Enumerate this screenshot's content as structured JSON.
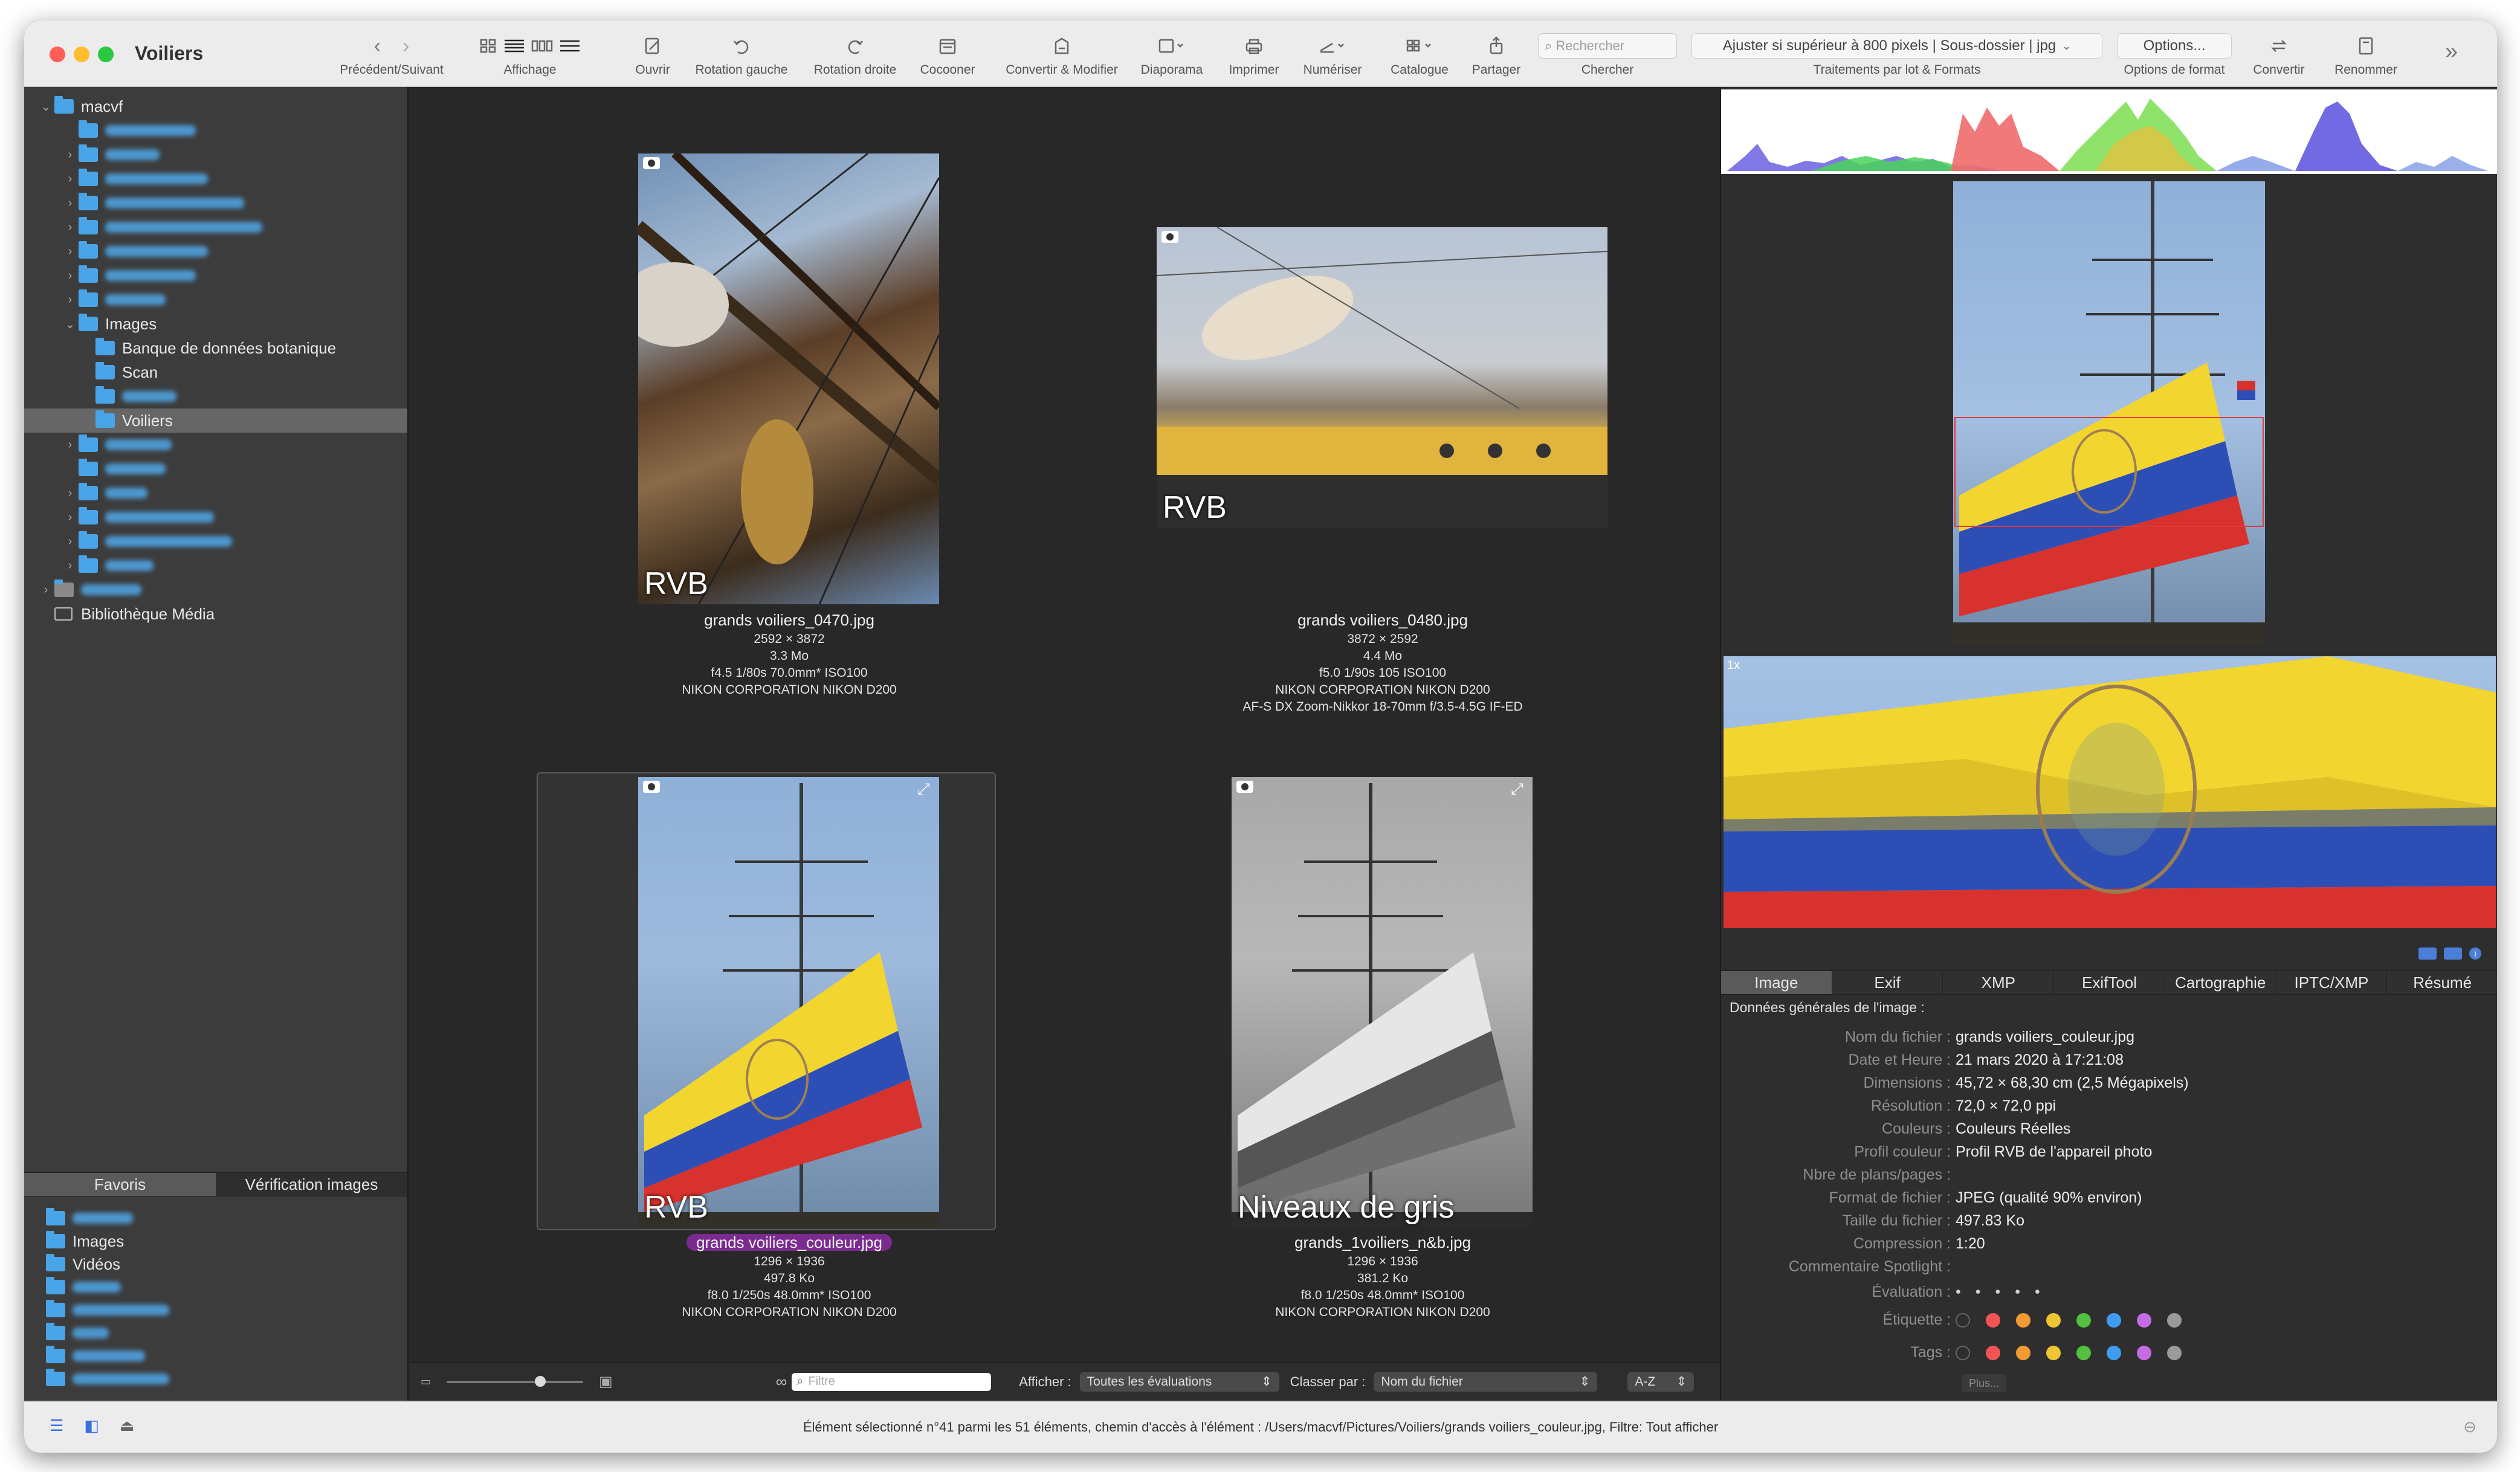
{
  "window": {
    "title": "Voiliers"
  },
  "toolbar": {
    "nav_label": "Précédent/Suivant",
    "view_label": "Affichage",
    "open_label": "Ouvrir",
    "rotate_left_label": "Rotation gauche",
    "rotate_right_label": "Rotation droite",
    "cocoon_label": "Cocooner",
    "convert_modify_label": "Convertir & Modifier",
    "slideshow_label": "Diaporama",
    "print_label": "Imprimer",
    "scan_label": "Numériser",
    "catalog_label": "Catalogue",
    "share_label": "Partager",
    "search_placeholder": "Rechercher",
    "search_label": "Chercher",
    "batch_value": "Ajuster si supérieur à 800 pixels | Sous-dossier | jpg",
    "batch_label": "Traitements par lot & Formats",
    "options_button": "Options...",
    "options_label": "Options de format",
    "convert_label": "Convertir",
    "rename_label": "Renommer"
  },
  "sidebar": {
    "root": "macvf",
    "images_folder": "Images",
    "subfolders": [
      "Banque de données botanique",
      "Scan",
      "Voiliers"
    ],
    "media_library": "Bibliothèque Média",
    "tabs": [
      "Favoris",
      "Vérification images"
    ],
    "favorites": [
      "Images",
      "Vidéos"
    ]
  },
  "thumbnails": [
    {
      "filename": "grands voiliers_0470.jpg",
      "dimensions": "2592 × 3872",
      "size": "3.3  Mo",
      "exposure": "f4.5 1/80s 70.0mm* ISO100",
      "camera": "NIKON CORPORATION NIKON D200",
      "lens": "",
      "badge": "RVB"
    },
    {
      "filename": "grands voiliers_0480.jpg",
      "dimensions": "3872 × 2592",
      "size": "4.4  Mo",
      "exposure": "f5.0 1/90s 105 ISO100",
      "camera": "NIKON CORPORATION NIKON D200",
      "lens": "AF-S DX Zoom-Nikkor 18-70mm f/3.5-4.5G IF-ED",
      "badge": "RVB"
    },
    {
      "filename": "grands voiliers_couleur.jpg",
      "dimensions": "1296 × 1936",
      "size": "497.8 Ko",
      "exposure": "f8.0 1/250s 48.0mm* ISO100",
      "camera": "NIKON CORPORATION NIKON D200",
      "lens": "",
      "badge": "RVB"
    },
    {
      "filename": "grands_1voiliers_n&b.jpg",
      "dimensions": "1296 × 1936",
      "size": "381.2 Ko",
      "exposure": "f8.0 1/250s 48.0mm* ISO100",
      "camera": "NIKON CORPORATION NIKON D200",
      "lens": "",
      "badge": "Niveaux de gris"
    }
  ],
  "grid_footer": {
    "filter_placeholder": "Filtre",
    "show_label": "Afficher :",
    "show_value": "Toutes les évaluations",
    "sort_label": "Classer par :",
    "sort_value": "Nom du fichier",
    "order_value": "A-Z"
  },
  "preview": {
    "zoom_label": "1x"
  },
  "inspector": {
    "tabs": [
      "Image",
      "Exif",
      "XMP",
      "ExifTool",
      "Cartographie",
      "IPTC/XMP",
      "Résumé"
    ],
    "section_title": "Données générales de l'image :",
    "rows": [
      {
        "key": "Nom du fichier :",
        "value": "grands voiliers_couleur.jpg"
      },
      {
        "key": "Date et Heure :",
        "value": "21 mars 2020 à 17:21:08"
      },
      {
        "key": "Dimensions :",
        "value": "45,72 × 68,30 cm (2,5 Mégapixels)"
      },
      {
        "key": "Résolution :",
        "value": "72,0 × 72,0 ppi"
      },
      {
        "key": "Couleurs :",
        "value": "Couleurs Réelles"
      },
      {
        "key": "Profil couleur :",
        "value": "Profil RVB de l'appareil photo"
      },
      {
        "key": "Nbre de plans/pages :",
        "value": ""
      },
      {
        "key": "Format de fichier :",
        "value": "JPEG (qualité 90% environ)"
      },
      {
        "key": "Taille du fichier :",
        "value": "497.83 Ko"
      },
      {
        "key": "Compression :",
        "value": "1:20"
      },
      {
        "key": "Commentaire Spotlight :",
        "value": ""
      }
    ],
    "rating_label": "Évaluation :",
    "label_label": "Étiquette :",
    "tags_label": "Tags :",
    "more_button": "Plus...",
    "label_colors": [
      "#f25454",
      "#f29a33",
      "#f0c534",
      "#52c13f",
      "#3f9cf0",
      "#c56be3",
      "#9a9a9a"
    ]
  },
  "statusbar": {
    "text": "Élément sélectionné n°41 parmi les 51 éléments, chemin d'accès à l'élément : /Users/macvf/Pictures/Voiliers/grands voiliers_couleur.jpg, Filtre: Tout afficher"
  }
}
